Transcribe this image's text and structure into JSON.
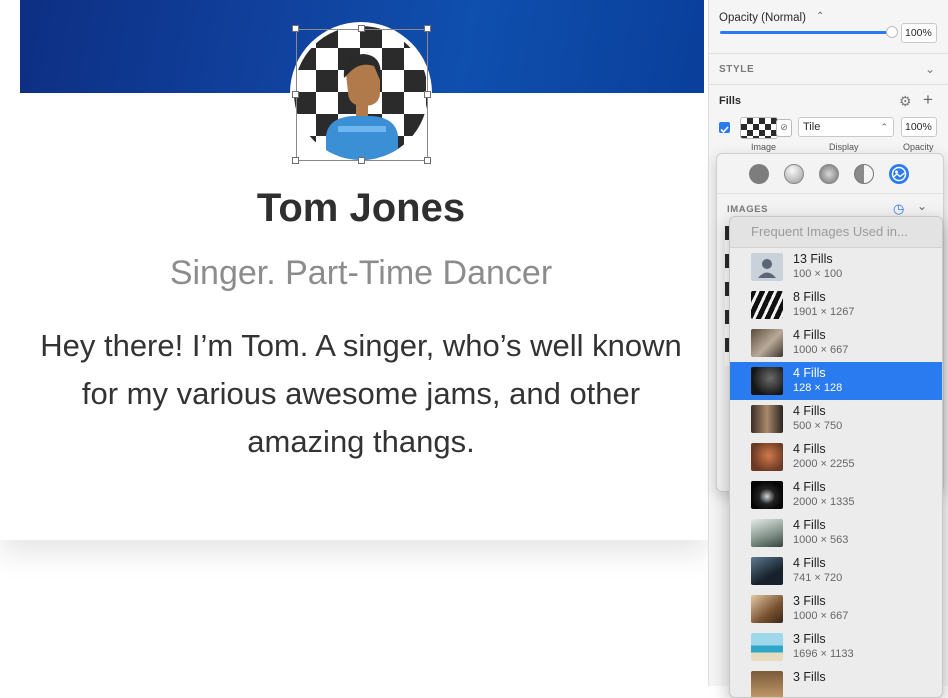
{
  "canvas": {
    "name": "Tom Jones",
    "tagline": "Singer. Part-Time Dancer",
    "bio": "Hey there! I’m Tom. A singer, who’s well known for my various awesome jams, and other amazing thangs."
  },
  "inspector": {
    "opacity_label": "Opacity (Normal)",
    "opacity_value": "100%",
    "opacity_level": 1.0,
    "style_header": "STYLE",
    "fills_header": "Fills",
    "fill": {
      "enabled": true,
      "display_mode": "Tile",
      "opacity": "100%",
      "col_image": "Image",
      "col_display": "Display",
      "col_opacity": "Opacity"
    }
  },
  "fill_popover": {
    "fill_types": [
      "solid-fill-icon",
      "linear-gradient-icon",
      "radial-gradient-icon",
      "angular-gradient-icon",
      "image-fill-icon"
    ],
    "images_header": "IMAGES"
  },
  "images_menu": {
    "header": "Frequent Images Used in...",
    "items": [
      {
        "count": "13 Fills",
        "size": "100 × 100",
        "thumb": "avatar-placeholder",
        "selected": false
      },
      {
        "count": "8 Fills",
        "size": "1901 × 1267",
        "thumb": "piano-keys",
        "selected": false
      },
      {
        "count": "4 Fills",
        "size": "1000 × 667",
        "thumb": "cafe-scene",
        "selected": false
      },
      {
        "count": "4 Fills",
        "size": "128 × 128",
        "thumb": "man-portrait",
        "selected": true
      },
      {
        "count": "4 Fills",
        "size": "500 × 750",
        "thumb": "person-standing",
        "selected": false
      },
      {
        "count": "4 Fills",
        "size": "2000 × 2255",
        "thumb": "red-hair-portrait",
        "selected": false
      },
      {
        "count": "4 Fills",
        "size": "2000 × 1335",
        "thumb": "dark-stage",
        "selected": false
      },
      {
        "count": "4 Fills",
        "size": "1000 × 563",
        "thumb": "desk-workspace",
        "selected": false
      },
      {
        "count": "4 Fills",
        "size": "741 × 720",
        "thumb": "man-hat",
        "selected": false
      },
      {
        "count": "3 Fills",
        "size": "1000 × 667",
        "thumb": "coffee-shop",
        "selected": false
      },
      {
        "count": "3 Fills",
        "size": "1696 × 1133",
        "thumb": "beach-scene",
        "selected": false
      },
      {
        "count": "3 Fills",
        "size": "",
        "thumb": "warm-portrait",
        "selected": false
      }
    ]
  },
  "colors": {
    "accent": "#2b7bf0",
    "banner": "#0f4fae"
  }
}
